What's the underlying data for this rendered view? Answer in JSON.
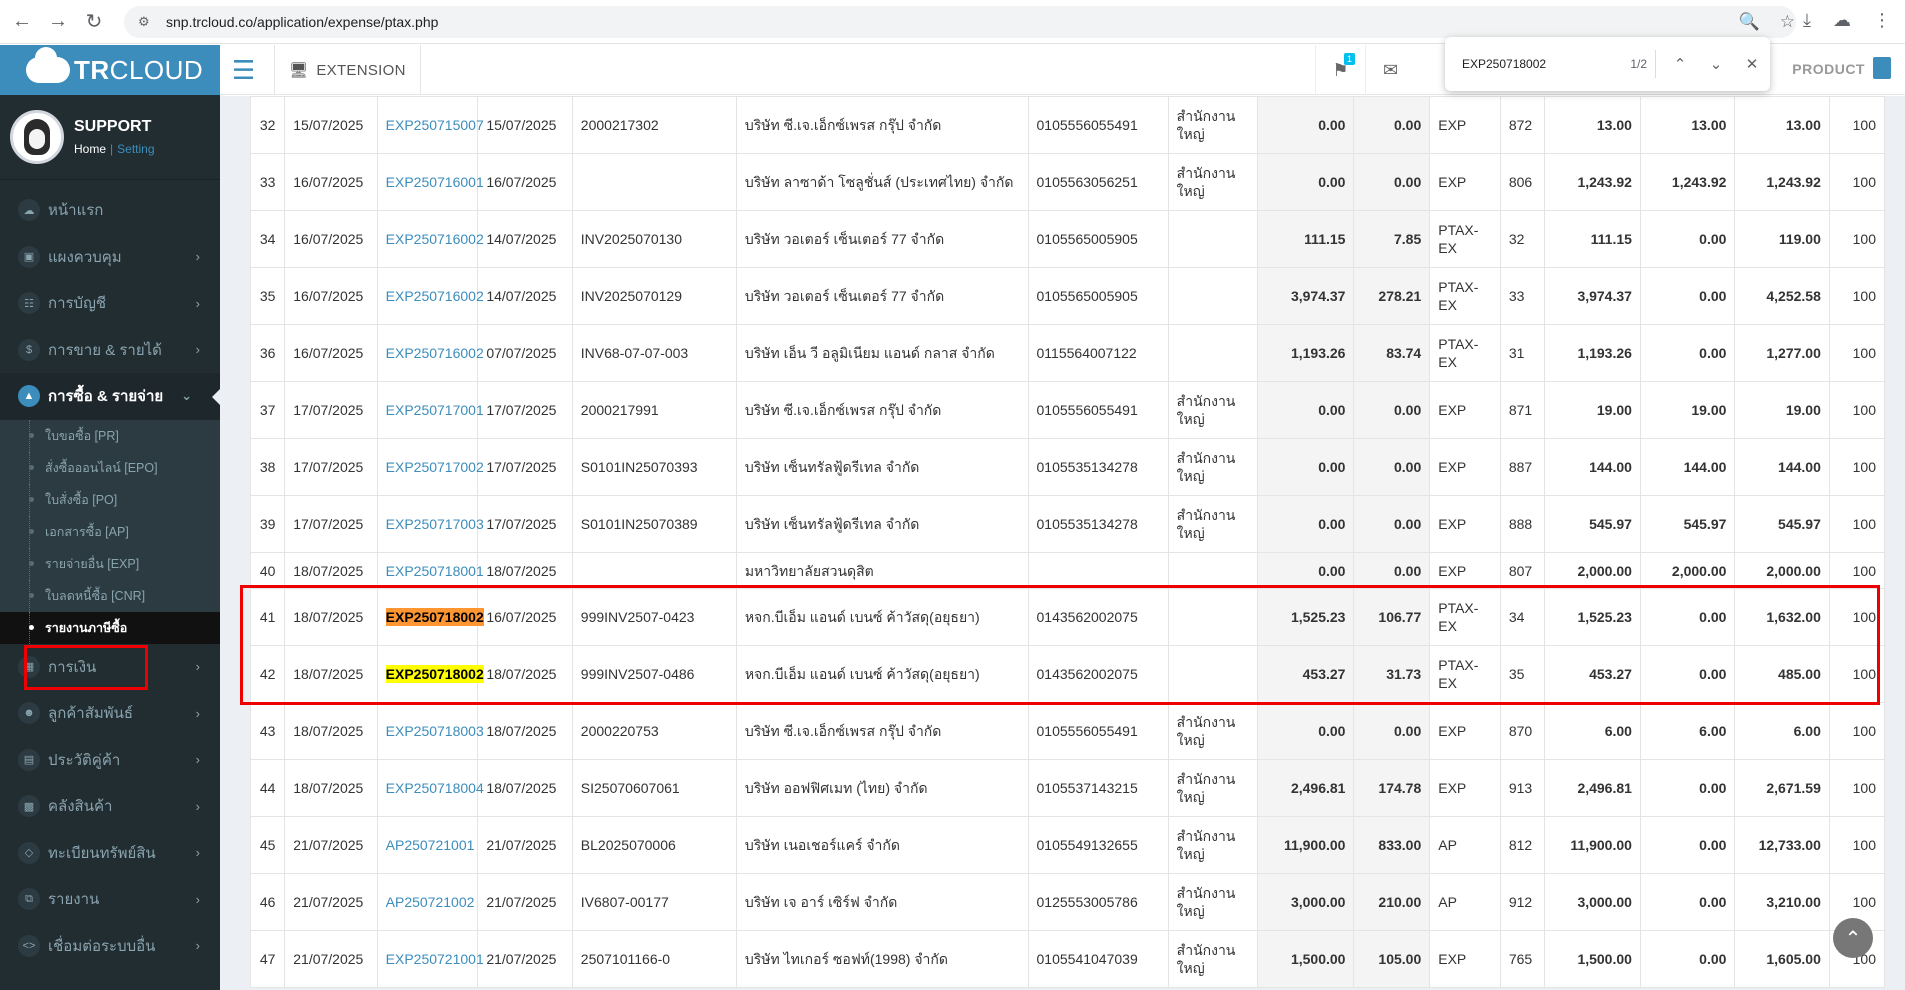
{
  "browser": {
    "url": "snp.trcloud.co/application/expense/ptax.php"
  },
  "find": {
    "query": "EXP250718002",
    "count": "1/2"
  },
  "logo": {
    "bold": "TR",
    "light": "CLOUD"
  },
  "user": {
    "name": "SUPPORT",
    "home": "Home",
    "sep": "|",
    "setting": "Setting"
  },
  "topbar": {
    "extension": "EXTENSION",
    "badge": "1",
    "product": "PRODUCT"
  },
  "menu": [
    {
      "label": "หน้าแรก",
      "icon": "cloud-icon",
      "chevron": false
    },
    {
      "label": "แผงควบคุม",
      "icon": "monitor-icon",
      "chevron": true
    },
    {
      "label": "การบัญชี",
      "icon": "book-icon",
      "chevron": true
    },
    {
      "label": "การขาย & รายได้",
      "icon": "dollar-icon",
      "chevron": true
    },
    {
      "label": "การซื้อ & รายจ่าย",
      "icon": "cart-icon",
      "chevron": true
    }
  ],
  "submenu": [
    "ใบขอซื้อ [PR]",
    "สั่งซื้อออนไลน์ [EPO]",
    "ใบสั่งซื้อ [PO]",
    "เอกสารซื้อ [AP]",
    "รายจ่ายอื่น [EXP]",
    "ใบลดหนี้ซื้อ [CNR]",
    "รายงานภาษีซื้อ"
  ],
  "menu2": [
    {
      "label": "การเงิน",
      "icon": "calendar-icon"
    },
    {
      "label": "ลูกค้าสัมพันธ์",
      "icon": "users-icon"
    },
    {
      "label": "ประวัติคู่ค้า",
      "icon": "contact-icon"
    },
    {
      "label": "คลังสินค้า",
      "icon": "cubes-icon"
    },
    {
      "label": "ทะเบียนทรัพย์สิน",
      "icon": "diamond-icon"
    },
    {
      "label": "รายงาน",
      "icon": "copy-icon"
    },
    {
      "label": "เชื่อมต่อระบบอื่น",
      "icon": "code-icon"
    }
  ],
  "rows": [
    {
      "no": "32",
      "date": "15/07/2025",
      "doc": "EXP250715007",
      "inv_date": "15/07/2025",
      "inv_no": "2000217302",
      "vendor": "บริษัท ซี.เจ.เอ็กซ์เพรส กรุ๊ป จำกัด",
      "tax_id": "0105556055491",
      "branch": "สำนักงานใหญ่",
      "base": "0.00",
      "vat": "0.00",
      "type": "EXP",
      "ref": "872",
      "c1": "13.00",
      "c2": "13.00",
      "c3": "13.00",
      "pct": "100"
    },
    {
      "no": "33",
      "date": "16/07/2025",
      "doc": "EXP250716001",
      "inv_date": "16/07/2025",
      "inv_no": "",
      "vendor": "บริษัท ลาซาด้า โซลูชั่นส์ (ประเทศไทย) จำกัด",
      "tax_id": "0105563056251",
      "branch": "สำนักงานใหญ่",
      "base": "0.00",
      "vat": "0.00",
      "type": "EXP",
      "ref": "806",
      "c1": "1,243.92",
      "c2": "1,243.92",
      "c3": "1,243.92",
      "pct": "100"
    },
    {
      "no": "34",
      "date": "16/07/2025",
      "doc": "EXP250716002",
      "inv_date": "14/07/2025",
      "inv_no": "INV2025070130",
      "vendor": "บริษัท วอเตอร์ เซ็นเตอร์ 77 จำกัด",
      "tax_id": "0105565005905",
      "branch": "",
      "base": "111.15",
      "vat": "7.85",
      "type": "PTAX-EX",
      "ref": "32",
      "c1": "111.15",
      "c2": "0.00",
      "c3": "119.00",
      "pct": "100"
    },
    {
      "no": "35",
      "date": "16/07/2025",
      "doc": "EXP250716002",
      "inv_date": "14/07/2025",
      "inv_no": "INV2025070129",
      "vendor": "บริษัท วอเตอร์ เซ็นเตอร์ 77 จำกัด",
      "tax_id": "0105565005905",
      "branch": "",
      "base": "3,974.37",
      "vat": "278.21",
      "type": "PTAX-EX",
      "ref": "33",
      "c1": "3,974.37",
      "c2": "0.00",
      "c3": "4,252.58",
      "pct": "100"
    },
    {
      "no": "36",
      "date": "16/07/2025",
      "doc": "EXP250716002",
      "inv_date": "07/07/2025",
      "inv_no": "INV68-07-07-003",
      "vendor": "บริษัท เอ็น วี อลูมิเนียม แอนด์ กลาส จำกัด",
      "tax_id": "0115564007122",
      "branch": "",
      "base": "1,193.26",
      "vat": "83.74",
      "type": "PTAX-EX",
      "ref": "31",
      "c1": "1,193.26",
      "c2": "0.00",
      "c3": "1,277.00",
      "pct": "100"
    },
    {
      "no": "37",
      "date": "17/07/2025",
      "doc": "EXP250717001",
      "inv_date": "17/07/2025",
      "inv_no": "2000217991",
      "vendor": "บริษัท ซี.เจ.เอ็กซ์เพรส กรุ๊ป จำกัด",
      "tax_id": "0105556055491",
      "branch": "สำนักงานใหญ่",
      "base": "0.00",
      "vat": "0.00",
      "type": "EXP",
      "ref": "871",
      "c1": "19.00",
      "c2": "19.00",
      "c3": "19.00",
      "pct": "100"
    },
    {
      "no": "38",
      "date": "17/07/2025",
      "doc": "EXP250717002",
      "inv_date": "17/07/2025",
      "inv_no": "S0101IN25070393",
      "vendor": "บริษัท เซ็นทรัลฟู้ดรีเทล จำกัด",
      "tax_id": "0105535134278",
      "branch": "สำนักงานใหญ่",
      "base": "0.00",
      "vat": "0.00",
      "type": "EXP",
      "ref": "887",
      "c1": "144.00",
      "c2": "144.00",
      "c3": "144.00",
      "pct": "100"
    },
    {
      "no": "39",
      "date": "17/07/2025",
      "doc": "EXP250717003",
      "inv_date": "17/07/2025",
      "inv_no": "S0101IN25070389",
      "vendor": "บริษัท เซ็นทรัลฟู้ดรีเทล จำกัด",
      "tax_id": "0105535134278",
      "branch": "สำนักงานใหญ่",
      "base": "0.00",
      "vat": "0.00",
      "type": "EXP",
      "ref": "888",
      "c1": "545.97",
      "c2": "545.97",
      "c3": "545.97",
      "pct": "100"
    },
    {
      "no": "40",
      "date": "18/07/2025",
      "doc": "EXP250718001",
      "inv_date": "18/07/2025",
      "inv_no": "",
      "vendor": "มหาวิทยาลัยสวนดุสิต",
      "tax_id": "",
      "branch": "",
      "base": "0.00",
      "vat": "0.00",
      "type": "EXP",
      "ref": "807",
      "c1": "2,000.00",
      "c2": "2,000.00",
      "c3": "2,000.00",
      "pct": "100",
      "short": true
    },
    {
      "no": "41",
      "date": "18/07/2025",
      "doc": "EXP250718002",
      "inv_date": "16/07/2025",
      "inv_no": "999INV2507-0423",
      "vendor": "หจก.บีเอ็ม แอนด์ เบนซ์ ค้าวัสดุ(อยุธยา)",
      "tax_id": "0143562002075",
      "branch": "",
      "base": "1,525.23",
      "vat": "106.77",
      "type": "PTAX-EX",
      "ref": "34",
      "c1": "1,525.23",
      "c2": "0.00",
      "c3": "1,632.00",
      "pct": "100",
      "hl": "orange"
    },
    {
      "no": "42",
      "date": "18/07/2025",
      "doc": "EXP250718002",
      "inv_date": "18/07/2025",
      "inv_no": "999INV2507-0486",
      "vendor": "หจก.บีเอ็ม แอนด์ เบนซ์ ค้าวัสดุ(อยุธยา)",
      "tax_id": "0143562002075",
      "branch": "",
      "base": "453.27",
      "vat": "31.73",
      "type": "PTAX-EX",
      "ref": "35",
      "c1": "453.27",
      "c2": "0.00",
      "c3": "485.00",
      "pct": "100",
      "hl": "yellow"
    },
    {
      "no": "43",
      "date": "18/07/2025",
      "doc": "EXP250718003",
      "inv_date": "18/07/2025",
      "inv_no": "2000220753",
      "vendor": "บริษัท ซี.เจ.เอ็กซ์เพรส กรุ๊ป จำกัด",
      "tax_id": "0105556055491",
      "branch": "สำนักงานใหญ่",
      "base": "0.00",
      "vat": "0.00",
      "type": "EXP",
      "ref": "870",
      "c1": "6.00",
      "c2": "6.00",
      "c3": "6.00",
      "pct": "100"
    },
    {
      "no": "44",
      "date": "18/07/2025",
      "doc": "EXP250718004",
      "inv_date": "18/07/2025",
      "inv_no": "SI25070607061",
      "vendor": "บริษัท ออฟฟิศเมท (ไทย) จำกัด",
      "tax_id": "0105537143215",
      "branch": "สำนักงานใหญ่",
      "base": "2,496.81",
      "vat": "174.78",
      "type": "EXP",
      "ref": "913",
      "c1": "2,496.81",
      "c2": "0.00",
      "c3": "2,671.59",
      "pct": "100"
    },
    {
      "no": "45",
      "date": "21/07/2025",
      "doc": "AP250721001",
      "inv_date": "21/07/2025",
      "inv_no": "BL2025070006",
      "vendor": "บริษัท เนอเชอร์แคร์ จำกัด",
      "tax_id": "0105549132655",
      "branch": "สำนักงานใหญ่",
      "base": "11,900.00",
      "vat": "833.00",
      "type": "AP",
      "ref": "812",
      "c1": "11,900.00",
      "c2": "0.00",
      "c3": "12,733.00",
      "pct": "100"
    },
    {
      "no": "46",
      "date": "21/07/2025",
      "doc": "AP250721002",
      "inv_date": "21/07/2025",
      "inv_no": "IV6807-00177",
      "vendor": "บริษัท เจ อาร์ เซิร์ฟ จำกัด",
      "tax_id": "0125553005786",
      "branch": "สำนักงานใหญ่",
      "base": "3,000.00",
      "vat": "210.00",
      "type": "AP",
      "ref": "912",
      "c1": "3,000.00",
      "c2": "0.00",
      "c3": "3,210.00",
      "pct": "100"
    },
    {
      "no": "47",
      "date": "21/07/2025",
      "doc": "EXP250721001",
      "inv_date": "21/07/2025",
      "inv_no": "2507101166-0",
      "vendor": "บริษัท ไทเกอร์ ซอฟท์(1998) จำกัด",
      "tax_id": "0105541047039",
      "branch": "สำนักงานใหญ่",
      "base": "1,500.00",
      "vat": "105.00",
      "type": "EXP",
      "ref": "765",
      "c1": "1,500.00",
      "c2": "0.00",
      "c3": "1,605.00",
      "pct": "100"
    }
  ],
  "colors": {
    "brand": "#3c8dbc",
    "sidebar": "#222d32",
    "highlight_red": "#ee0000",
    "find_current": "#ff9632",
    "find_match": "#ffff00"
  }
}
